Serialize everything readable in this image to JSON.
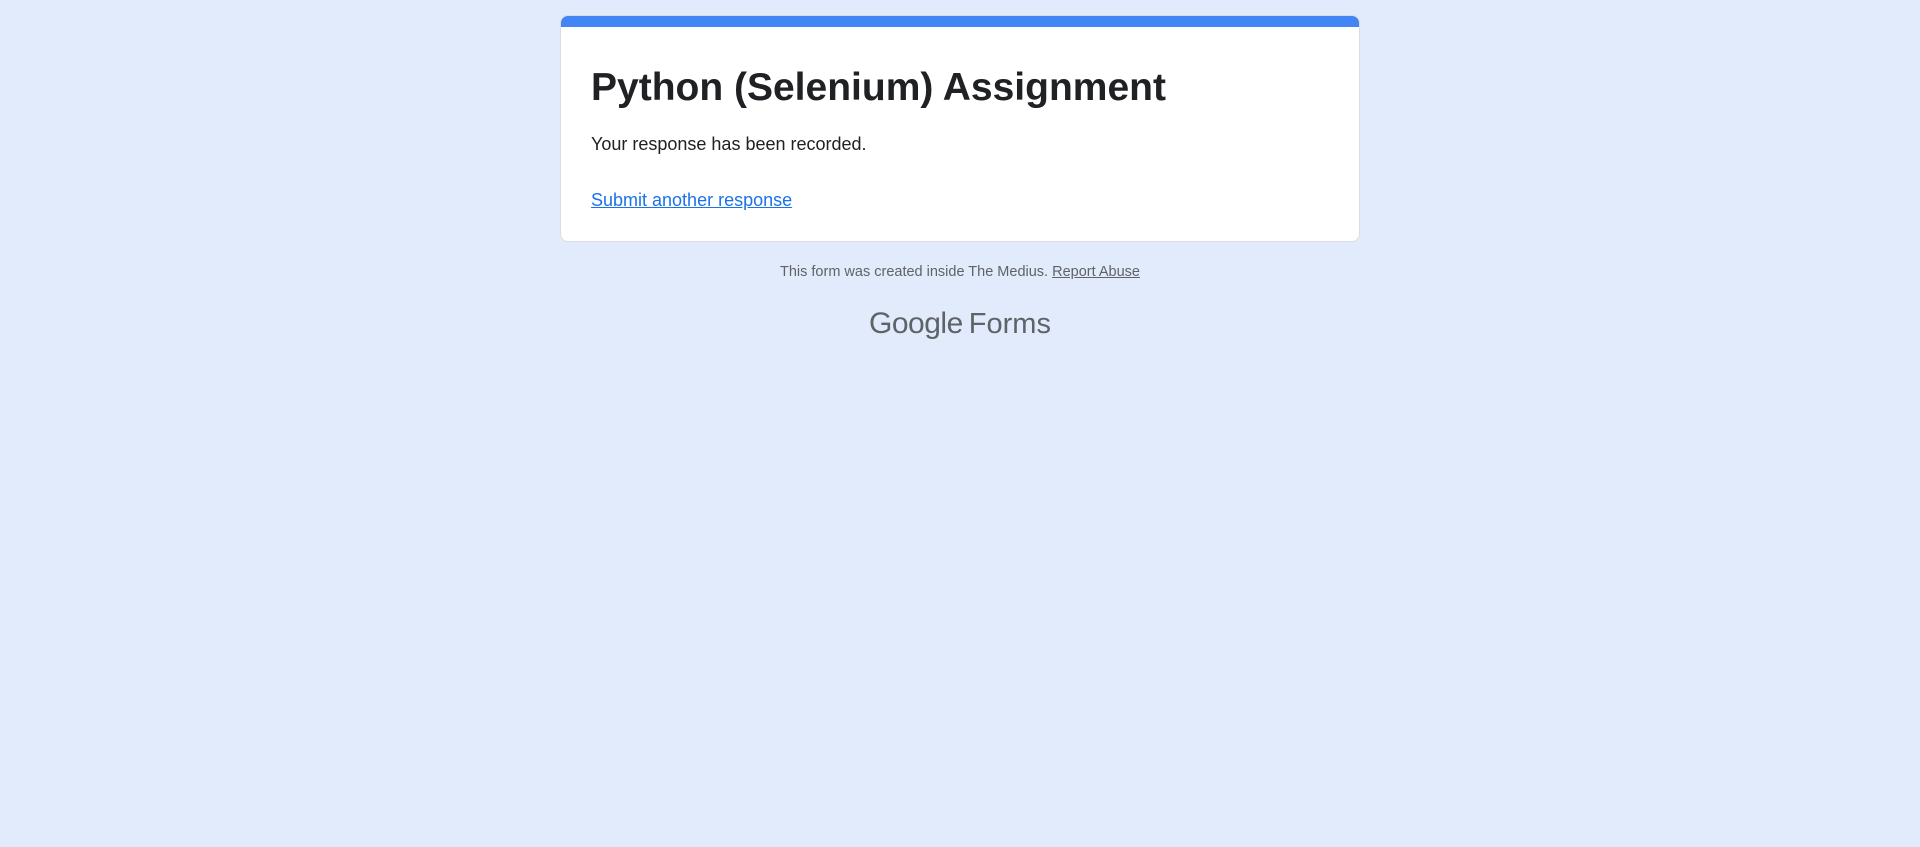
{
  "form": {
    "title": "Python (Selenium) Assignment",
    "confirmation_message": "Your response has been recorded.",
    "submit_another_label": "Submit another response"
  },
  "footer": {
    "created_inside_text": "This form was created inside The Medius.",
    "report_abuse_label": "Report Abuse"
  },
  "brand": {
    "google_word": "Google",
    "forms_word": "Forms"
  },
  "colors": {
    "background": "#e2ebfc",
    "accent": "#4285f4",
    "link": "#1a73e8",
    "card": "#ffffff"
  }
}
